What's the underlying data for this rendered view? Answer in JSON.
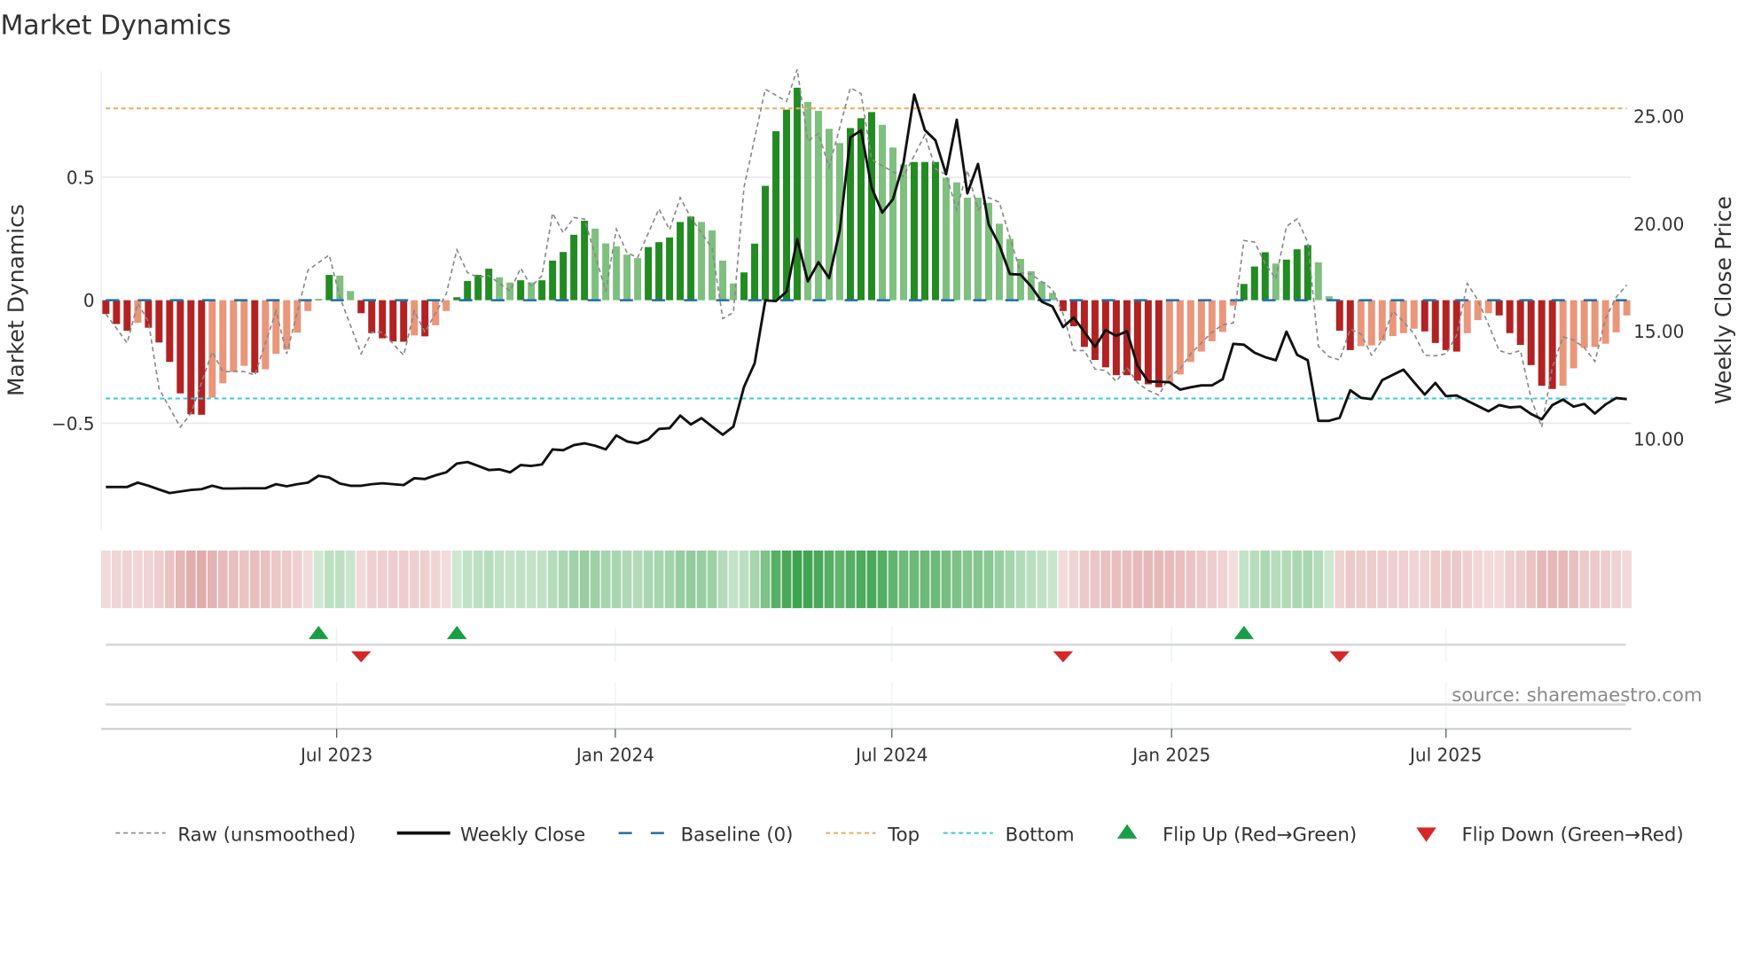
{
  "chart_data": {
    "type": "bar",
    "title": "Market Dynamics",
    "ylabel": "Market Dynamics",
    "y2label": "Weekly Close Price",
    "ylim": [
      -0.86,
      0.93
    ],
    "y2lim": [
      6.0,
      27.0
    ],
    "yticks": [
      {
        "value": 0.5,
        "label": "0.5"
      },
      {
        "value": 0,
        "label": "0"
      },
      {
        "value": -0.5,
        "label": "−0.5"
      }
    ],
    "y2ticks": [
      {
        "value": 25,
        "label": "25.00"
      },
      {
        "value": 20,
        "label": "20.00"
      },
      {
        "value": 15,
        "label": "15.00"
      },
      {
        "value": 10,
        "label": "10.00"
      }
    ],
    "x_unit": "week index",
    "xticks": [
      {
        "week": 21.7,
        "label": "Jul 2023"
      },
      {
        "week": 47.9,
        "label": "Jan 2024"
      },
      {
        "week": 73.9,
        "label": "Jul 2024"
      },
      {
        "week": 100.2,
        "label": "Jan 2025"
      },
      {
        "week": 126.0,
        "label": "Jul 2025"
      }
    ],
    "grid": true,
    "top_level": 0.78,
    "bottom_level": -0.4,
    "baseline": 0,
    "values": [
      -0.056,
      -0.097,
      -0.124,
      -0.092,
      -0.112,
      -0.172,
      -0.251,
      -0.379,
      -0.464,
      -0.466,
      -0.396,
      -0.338,
      -0.292,
      -0.267,
      -0.295,
      -0.281,
      -0.218,
      -0.201,
      -0.132,
      -0.044,
      0.004,
      0.103,
      0.1,
      0.037,
      -0.053,
      -0.134,
      -0.155,
      -0.168,
      -0.169,
      -0.143,
      -0.147,
      -0.102,
      -0.044,
      0.012,
      0.078,
      0.103,
      0.128,
      0.093,
      0.072,
      0.081,
      0.072,
      0.081,
      0.161,
      0.196,
      0.266,
      0.323,
      0.291,
      0.231,
      0.219,
      0.185,
      0.171,
      0.216,
      0.236,
      0.255,
      0.318,
      0.34,
      0.318,
      0.284,
      0.161,
      0.068,
      0.113,
      0.23,
      0.465,
      0.687,
      0.775,
      0.864,
      0.806,
      0.77,
      0.697,
      0.639,
      0.7,
      0.74,
      0.765,
      0.713,
      0.621,
      0.552,
      0.562,
      0.562,
      0.562,
      0.498,
      0.479,
      0.417,
      0.417,
      0.396,
      0.311,
      0.249,
      0.168,
      0.118,
      0.075,
      0.03,
      -0.044,
      -0.106,
      -0.19,
      -0.243,
      -0.273,
      -0.305,
      -0.305,
      -0.327,
      -0.342,
      -0.354,
      -0.336,
      -0.302,
      -0.251,
      -0.209,
      -0.167,
      -0.129,
      -0.022,
      0.066,
      0.137,
      0.195,
      0.149,
      0.165,
      0.207,
      0.224,
      0.154,
      0.016,
      -0.124,
      -0.203,
      -0.187,
      -0.184,
      -0.165,
      -0.146,
      -0.134,
      -0.116,
      -0.127,
      -0.174,
      -0.203,
      -0.209,
      -0.134,
      -0.081,
      -0.053,
      -0.062,
      -0.134,
      -0.182,
      -0.264,
      -0.348,
      -0.361,
      -0.348,
      -0.277,
      -0.194,
      -0.19,
      -0.177,
      -0.131,
      -0.062
    ],
    "strong": [
      1,
      1,
      1,
      0,
      1,
      1,
      1,
      1,
      1,
      1,
      0,
      0,
      0,
      0,
      1,
      0,
      0,
      0,
      0,
      0,
      1,
      1,
      0,
      0,
      1,
      1,
      1,
      1,
      1,
      0,
      1,
      0,
      0,
      1,
      1,
      1,
      1,
      0,
      0,
      1,
      0,
      1,
      1,
      1,
      1,
      1,
      0,
      0,
      0,
      0,
      0,
      1,
      1,
      1,
      1,
      1,
      0,
      0,
      0,
      0,
      1,
      1,
      1,
      1,
      1,
      1,
      0,
      0,
      0,
      0,
      1,
      1,
      1,
      0,
      0,
      0,
      1,
      1,
      1,
      0,
      0,
      0,
      0,
      0,
      0,
      0,
      0,
      0,
      0,
      0,
      1,
      1,
      1,
      1,
      1,
      1,
      1,
      1,
      1,
      1,
      0,
      0,
      0,
      0,
      0,
      0,
      0,
      1,
      1,
      1,
      0,
      1,
      1,
      1,
      0,
      0,
      1,
      1,
      0,
      0,
      0,
      0,
      0,
      0,
      1,
      1,
      1,
      1,
      0,
      0,
      0,
      1,
      1,
      1,
      1,
      1,
      1,
      0,
      0,
      0,
      0,
      0,
      0,
      0
    ],
    "raw_points": [
      [
        0,
        -0.056
      ],
      [
        2,
        -0.174
      ],
      [
        3,
        -0.012
      ],
      [
        4,
        -0.087
      ],
      [
        5,
        -0.36
      ],
      [
        7,
        -0.516
      ],
      [
        8,
        -0.46
      ],
      [
        10,
        -0.21
      ],
      [
        11,
        -0.29
      ],
      [
        13,
        -0.29
      ],
      [
        14,
        -0.305
      ],
      [
        16,
        -0.044
      ],
      [
        17,
        -0.218
      ],
      [
        19,
        0.122
      ],
      [
        21,
        0.184
      ],
      [
        22,
        0.012
      ],
      [
        24,
        -0.218
      ],
      [
        25,
        -0.13
      ],
      [
        26,
        -0.13
      ],
      [
        28,
        -0.224
      ],
      [
        29,
        -0.044
      ],
      [
        30,
        -0.13
      ],
      [
        32,
        0.025
      ],
      [
        33,
        0.205
      ],
      [
        34,
        0.112
      ],
      [
        35,
        0.093
      ],
      [
        36,
        0.1
      ],
      [
        38,
        0.037
      ],
      [
        39,
        0.13
      ],
      [
        40,
        0.056
      ],
      [
        41,
        0.1
      ],
      [
        42,
        0.354
      ],
      [
        43,
        0.274
      ],
      [
        44,
        0.336
      ],
      [
        45,
        0.33
      ],
      [
        47,
        0.037
      ],
      [
        48,
        0.289
      ],
      [
        49,
        0.193
      ],
      [
        50,
        0.174
      ],
      [
        52,
        0.371
      ],
      [
        53,
        0.286
      ],
      [
        54,
        0.417
      ],
      [
        55,
        0.336
      ],
      [
        57,
        0.211
      ],
      [
        58,
        -0.075
      ],
      [
        59,
        -0.05
      ],
      [
        60,
        0.46
      ],
      [
        62,
        0.858
      ],
      [
        64,
        0.808
      ],
      [
        65,
        0.939
      ],
      [
        66,
        0.647
      ],
      [
        67,
        0.678
      ],
      [
        68,
        0.541
      ],
      [
        70,
        0.864
      ],
      [
        71,
        0.84
      ],
      [
        72,
        0.572
      ],
      [
        74,
        0.522
      ],
      [
        75,
        0.504
      ],
      [
        77,
        0.672
      ],
      [
        78,
        0.535
      ],
      [
        79,
        0.51
      ],
      [
        80,
        0.367
      ],
      [
        81,
        0.529
      ],
      [
        82,
        0.367
      ],
      [
        83,
        0.417
      ],
      [
        84,
        0.398
      ],
      [
        86,
        0.112
      ],
      [
        87,
        0.106
      ],
      [
        89,
        0.044
      ],
      [
        90,
        -0.056
      ],
      [
        91,
        -0.205
      ],
      [
        92,
        -0.205
      ],
      [
        93,
        -0.28
      ],
      [
        94,
        -0.286
      ],
      [
        95,
        -0.33
      ],
      [
        96,
        -0.274
      ],
      [
        97,
        -0.336
      ],
      [
        98,
        -0.367
      ],
      [
        99,
        -0.386
      ],
      [
        100,
        -0.311
      ],
      [
        101,
        -0.28
      ],
      [
        102,
        -0.218
      ],
      [
        103,
        -0.174
      ],
      [
        104,
        -0.13
      ],
      [
        105,
        -0.1
      ],
      [
        106,
        -0.093
      ],
      [
        107,
        0.243
      ],
      [
        108,
        0.236
      ],
      [
        109,
        0.149
      ],
      [
        110,
        0.087
      ],
      [
        111,
        0.3
      ],
      [
        112,
        0.33
      ],
      [
        113,
        0.236
      ],
      [
        114,
        -0.187
      ],
      [
        115,
        -0.23
      ],
      [
        116,
        -0.243
      ],
      [
        117,
        -0.118
      ],
      [
        118,
        -0.137
      ],
      [
        119,
        -0.224
      ],
      [
        120,
        -0.162
      ],
      [
        121,
        -0.044
      ],
      [
        122,
        -0.087
      ],
      [
        123,
        -0.137
      ],
      [
        124,
        -0.224
      ],
      [
        125,
        -0.226
      ],
      [
        126,
        -0.218
      ],
      [
        127,
        -0.143
      ],
      [
        128,
        0.068
      ],
      [
        129,
        0
      ],
      [
        130,
        -0.1
      ],
      [
        131,
        -0.205
      ],
      [
        132,
        -0.218
      ],
      [
        133,
        -0.205
      ],
      [
        134,
        -0.4
      ],
      [
        135,
        -0.516
      ],
      [
        136,
        -0.274
      ],
      [
        137,
        -0.149
      ],
      [
        138,
        -0.162
      ],
      [
        139,
        -0.193
      ],
      [
        140,
        -0.249
      ],
      [
        141,
        -0.075
      ],
      [
        142,
        0.012
      ],
      [
        143,
        0.062
      ]
    ],
    "weekly_close": [
      7.7,
      7.7,
      7.7,
      7.9,
      7.76,
      7.58,
      7.42,
      7.49,
      7.56,
      7.6,
      7.76,
      7.63,
      7.63,
      7.64,
      7.64,
      7.64,
      7.83,
      7.73,
      7.83,
      7.9,
      8.22,
      8.14,
      7.86,
      7.76,
      7.76,
      7.83,
      7.87,
      7.83,
      7.79,
      8.11,
      8.07,
      8.24,
      8.38,
      8.79,
      8.86,
      8.68,
      8.49,
      8.52,
      8.38,
      8.72,
      8.68,
      8.75,
      9.45,
      9.41,
      9.65,
      9.73,
      9.62,
      9.45,
      10.1,
      9.82,
      9.73,
      9.92,
      10.4,
      10.44,
      11.02,
      10.61,
      10.9,
      10.51,
      10.13,
      10.51,
      12.36,
      13.46,
      16.38,
      16.35,
      16.79,
      19.23,
      17.27,
      18.16,
      17.42,
      19.64,
      23.97,
      24.29,
      21.63,
      20.47,
      21.09,
      22.8,
      25.96,
      24.31,
      23.83,
      22.25,
      24.79,
      21.36,
      22.73,
      19.92,
      18.96,
      17.61,
      17.58,
      17.03,
      16.32,
      16.1,
      15.14,
      15.59,
      14.91,
      14.22,
      15.0,
      14.73,
      14.95,
      13.33,
      12.61,
      12.6,
      12.57,
      12.23,
      12.34,
      12.43,
      12.43,
      12.71,
      14.36,
      14.32,
      13.95,
      13.74,
      13.6,
      14.93,
      13.85,
      13.6,
      10.78,
      10.78,
      10.92,
      12.2,
      11.85,
      11.79,
      12.67,
      12.92,
      13.16,
      12.57,
      12.0,
      12.54,
      11.93,
      11.96,
      11.71,
      11.47,
      11.22,
      11.51,
      11.4,
      11.44,
      11.1,
      10.85,
      11.51,
      11.77,
      11.44,
      11.56,
      11.12,
      11.54,
      11.84,
      11.79
    ],
    "flip_up_weeks": [
      20,
      33,
      107
    ],
    "flip_down_weeks": [
      24,
      90,
      116
    ],
    "legend": {
      "placement": "bottom",
      "items": [
        {
          "label": "Raw (unsmoothed)",
          "kind": "raw"
        },
        {
          "label": "Weekly Close",
          "kind": "close"
        },
        {
          "label": "Baseline (0)",
          "kind": "baseline"
        },
        {
          "label": "Top",
          "kind": "top"
        },
        {
          "label": "Bottom",
          "kind": "bottom"
        },
        {
          "label": "Flip Up (Red→Green)",
          "kind": "up"
        },
        {
          "label": "Flip Down (Green→Red)",
          "kind": "down"
        }
      ]
    },
    "annotation": "source: sharemaestro.com"
  },
  "colors": {
    "pos_strong": "#228b22",
    "pos_weak": "#7fbf7f",
    "neg_strong": "#b22222",
    "neg_weak": "#e9967a",
    "raw": "#888888",
    "close": "#111111",
    "baseline": "#1f6fa8",
    "top": "#f0a860",
    "bottom": "#3cc8dc",
    "up": "#1a9e45",
    "down": "#d62728",
    "strip_green": "#3ea34f",
    "strip_red": "#c86464"
  }
}
